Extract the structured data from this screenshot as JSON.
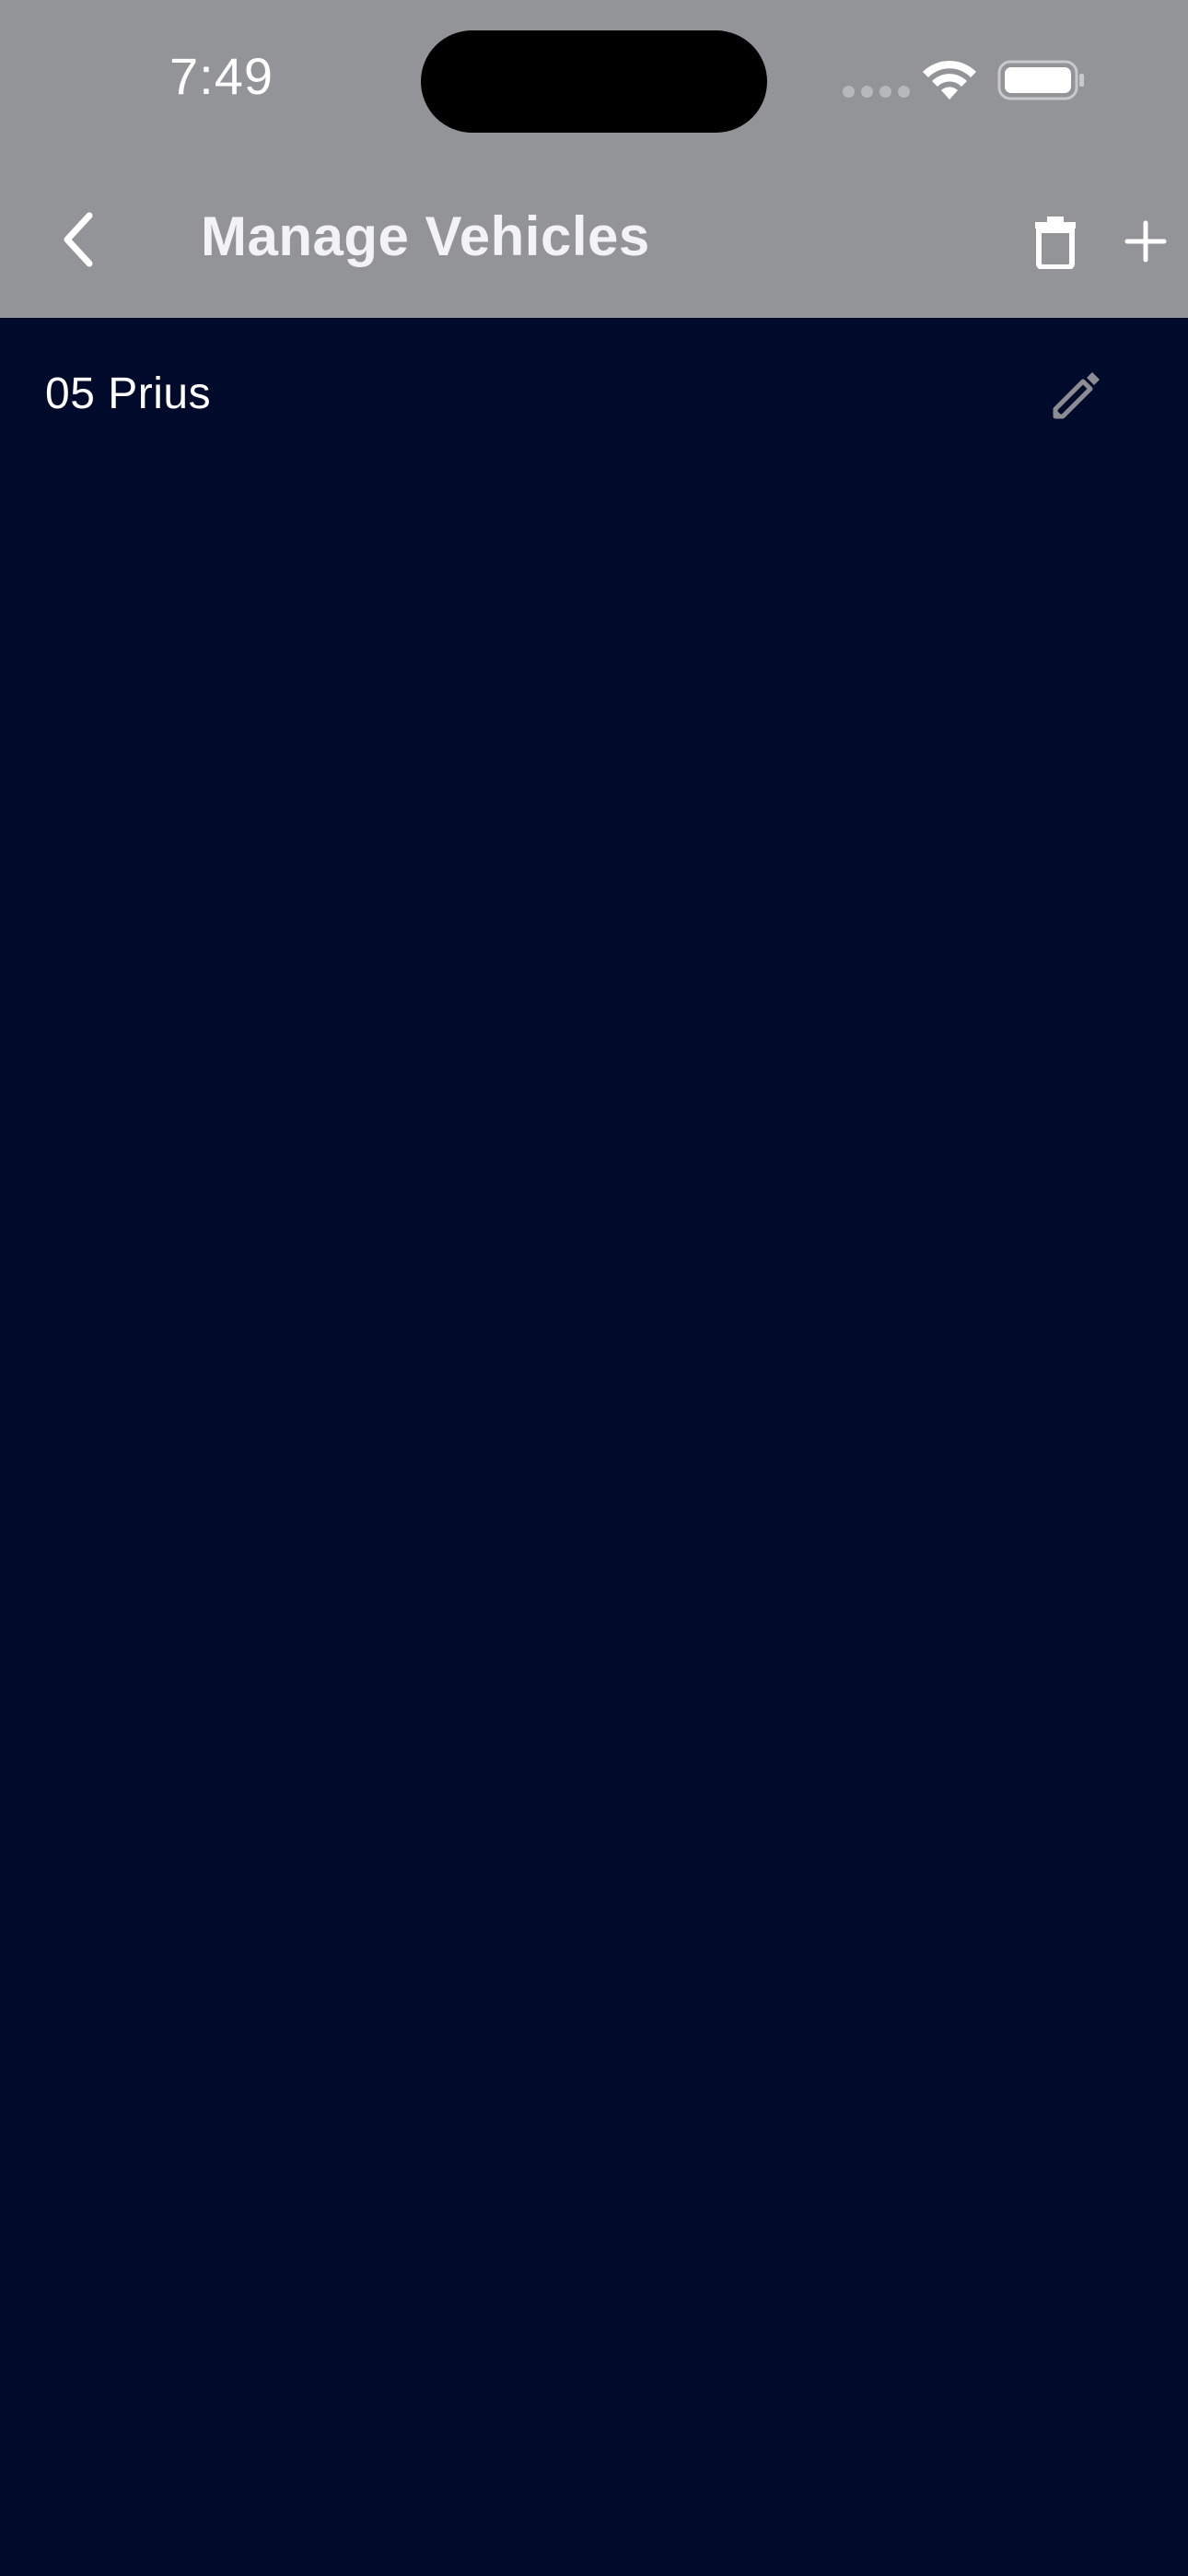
{
  "status_bar": {
    "time": "7:49"
  },
  "header": {
    "title": "Manage Vehicles",
    "back_icon": "chevron-left-icon",
    "delete_icon": "trash-icon",
    "add_icon": "plus-icon"
  },
  "vehicles": [
    {
      "name": "05 Prius",
      "edit_icon": "pencil-icon"
    }
  ],
  "colors": {
    "header_background": "#939497",
    "page_background": "#000a2b",
    "text": "#ffffff",
    "edit_icon": "#8c8d92"
  }
}
